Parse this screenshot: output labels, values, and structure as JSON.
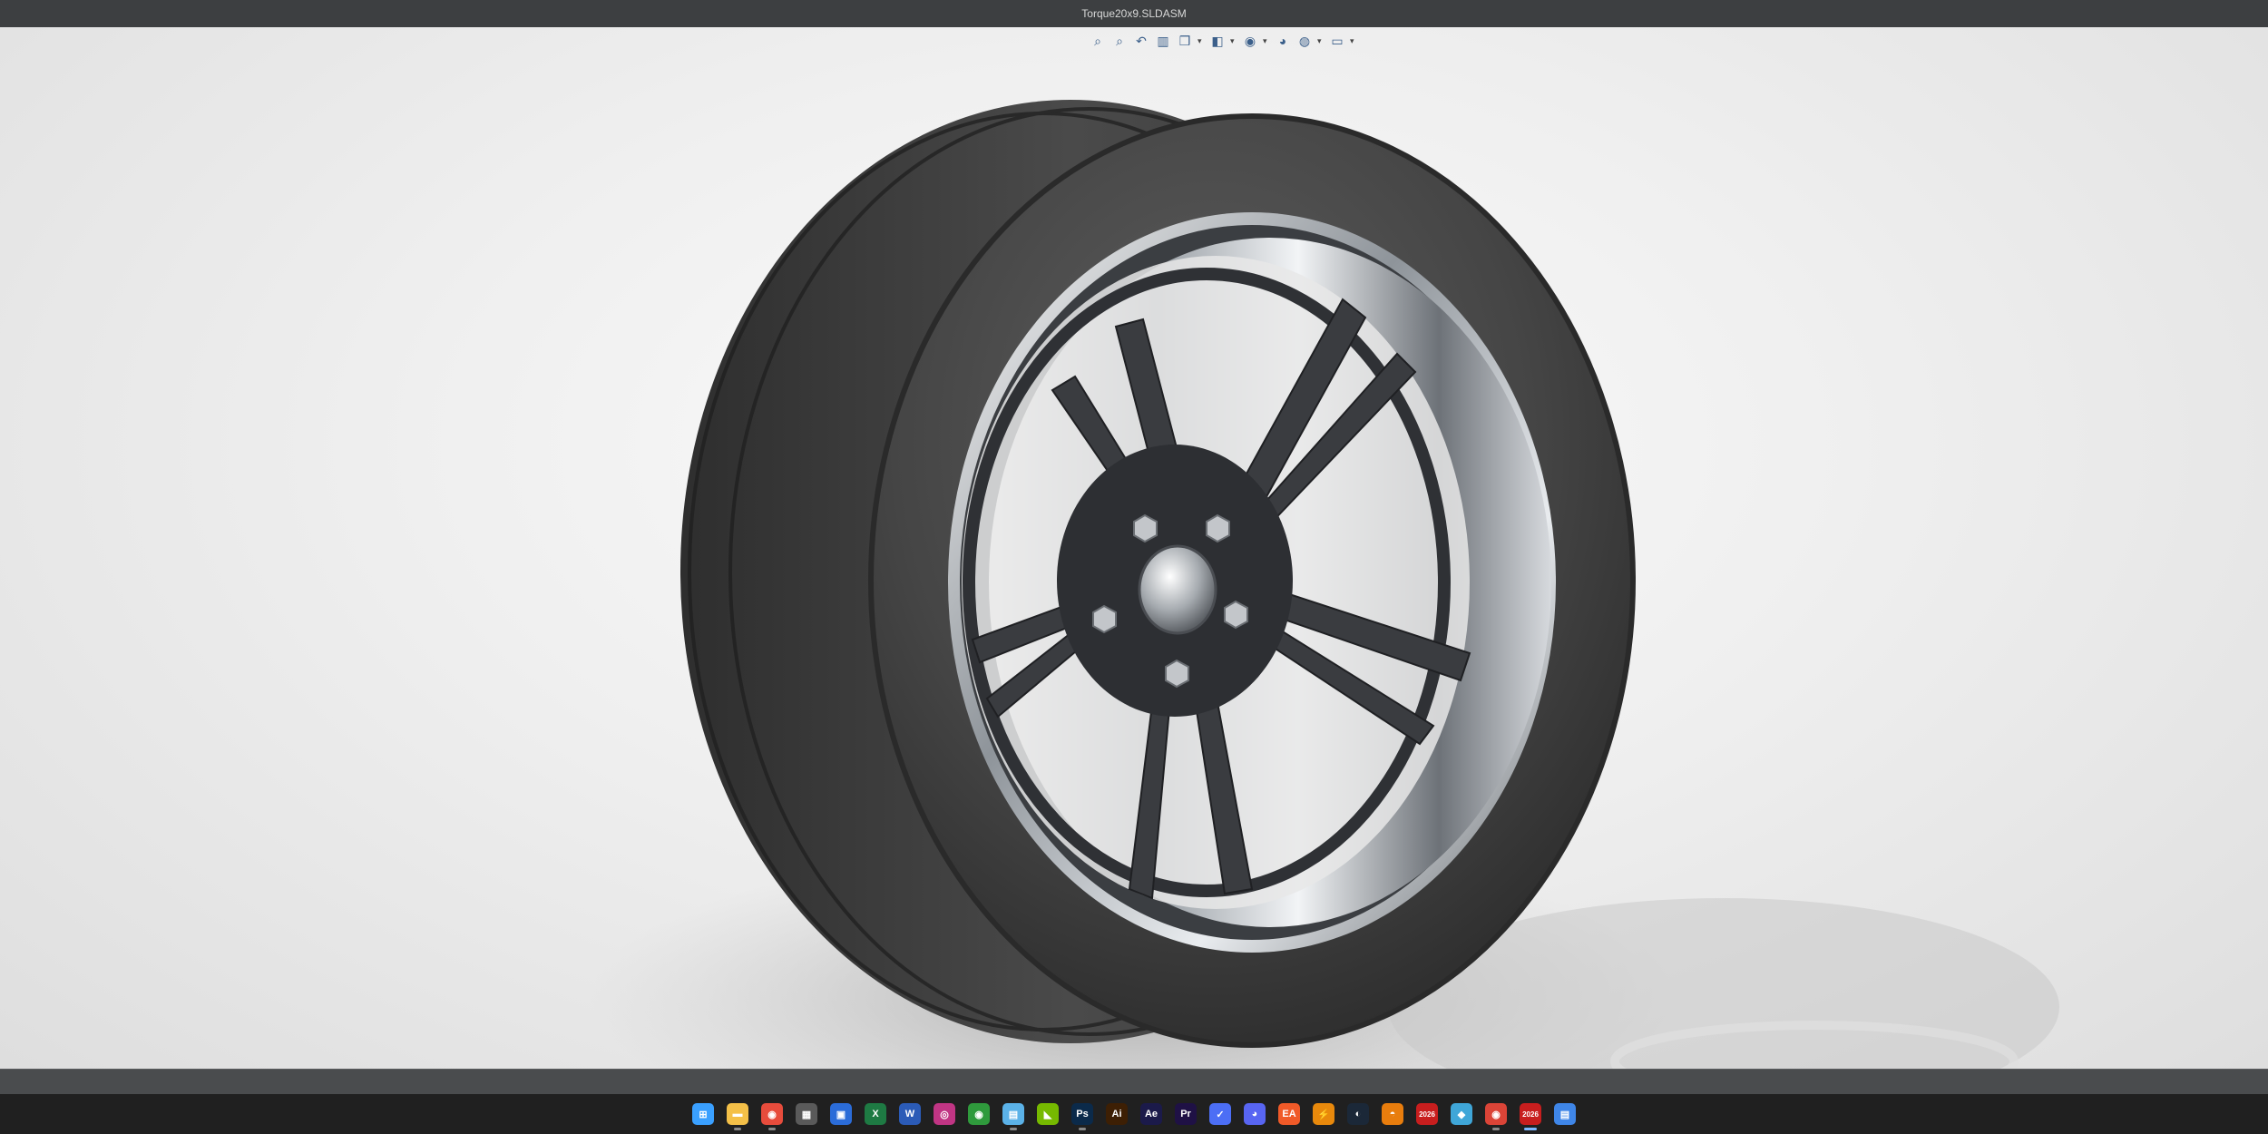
{
  "window": {
    "title": "Torque20x9.SLDASM"
  },
  "view_toolbar": {
    "buttons": [
      {
        "name": "zoom-to-fit-icon",
        "glyph": "⌕"
      },
      {
        "name": "zoom-to-area-icon",
        "glyph": "⌕"
      },
      {
        "name": "previous-view-icon",
        "glyph": "↶"
      },
      {
        "name": "section-view-icon",
        "glyph": "▥"
      },
      {
        "name": "view-orientation-icon",
        "glyph": "❒"
      },
      {
        "name": "display-style-icon",
        "glyph": "◧"
      },
      {
        "name": "hide-show-items-icon",
        "glyph": "◉"
      },
      {
        "name": "edit-appearance-icon",
        "glyph": "◕"
      },
      {
        "name": "apply-scene-icon",
        "glyph": "◍"
      },
      {
        "name": "view-settings-icon",
        "glyph": "▭"
      }
    ],
    "caret": "▾"
  },
  "taskbar": {
    "items": [
      {
        "name": "start-menu-icon",
        "label": "⊞",
        "color": "#3aa0ff",
        "running": false
      },
      {
        "name": "file-explorer-icon",
        "label": "▬",
        "color": "#f4c048",
        "running": true
      },
      {
        "name": "chrome-icon",
        "label": "◉",
        "color": "#e74c3c",
        "running": true
      },
      {
        "name": "calculator-icon",
        "label": "▦",
        "color": "#5a5a5a",
        "running": false
      },
      {
        "name": "store-icon",
        "label": "▣",
        "color": "#2b6cd8",
        "running": false
      },
      {
        "name": "excel-icon",
        "label": "X",
        "color": "#1e7a43",
        "running": false
      },
      {
        "name": "word-icon",
        "label": "W",
        "color": "#2b5bb7",
        "running": false
      },
      {
        "name": "instagram-icon",
        "label": "◎",
        "color": "#c13584",
        "running": false
      },
      {
        "name": "xbox-icon",
        "label": "◉",
        "color": "#2f9a3c",
        "running": false
      },
      {
        "name": "notepad-icon",
        "label": "▤",
        "color": "#5bb2e8",
        "running": true
      },
      {
        "name": "nvidia-icon",
        "label": "◣",
        "color": "#76b900",
        "running": false
      },
      {
        "name": "photoshop-icon",
        "label": "Ps",
        "color": "#0b2a4a",
        "running": true
      },
      {
        "name": "illustrator-icon",
        "label": "Ai",
        "color": "#3d1f04",
        "running": false
      },
      {
        "name": "after-effects-icon",
        "label": "Ae",
        "color": "#1b1a4a",
        "running": false
      },
      {
        "name": "premiere-icon",
        "label": "Pr",
        "color": "#1f1145",
        "running": false
      },
      {
        "name": "messenger-icon",
        "label": "✓",
        "color": "#4c6ef5",
        "running": false
      },
      {
        "name": "discord-icon",
        "label": "◕",
        "color": "#5865f2",
        "running": false
      },
      {
        "name": "ea-app-icon",
        "label": "EA",
        "color": "#f05a28",
        "running": false
      },
      {
        "name": "sketch-icon",
        "label": "⚡",
        "color": "#e8890c",
        "running": false
      },
      {
        "name": "steam-icon",
        "label": "◐",
        "color": "#1b2838",
        "running": false
      },
      {
        "name": "blender-icon",
        "label": "◓",
        "color": "#e87d0d",
        "running": false
      },
      {
        "name": "solidworks-2026-icon",
        "label": "2026",
        "color": "#c81e1e",
        "running": false
      },
      {
        "name": "cube-app-icon",
        "label": "◆",
        "color": "#3fa6d8",
        "running": false
      },
      {
        "name": "chrome-profile-icon",
        "label": "◉",
        "color": "#db4437",
        "running": true
      },
      {
        "name": "solidworks-2026-active-icon",
        "label": "2026",
        "color": "#c81e1e",
        "running": true,
        "active": true
      },
      {
        "name": "notes-icon",
        "label": "▤",
        "color": "#3f86e8",
        "running": false
      }
    ]
  }
}
